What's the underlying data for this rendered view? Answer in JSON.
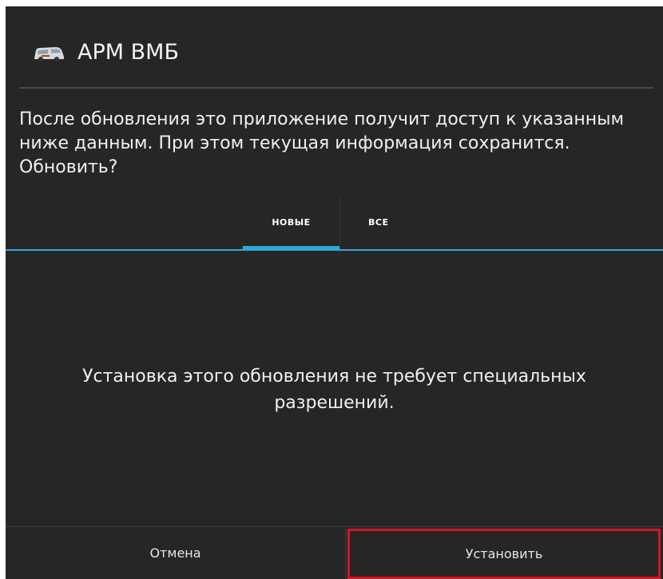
{
  "header": {
    "app_icon": "ambulance-icon",
    "title": "АРМ ВМБ"
  },
  "message": "После обновления это приложение получит доступ к указанным ниже данным. При этом текущая информация сохранится. Обновить?",
  "tabs": [
    {
      "label": "НОВЫЕ",
      "selected": true
    },
    {
      "label": "ВСЕ",
      "selected": false
    }
  ],
  "content": {
    "text_line1": "Установка этого обновления не требует специальных",
    "text_line2": "разрешений."
  },
  "buttons": {
    "cancel_label": "Отмена",
    "install_label": "Установить"
  },
  "colors": {
    "background": "#262626",
    "accent": "#2ea8d6",
    "highlight": "#d0162a",
    "text": "#f0f0f0"
  }
}
